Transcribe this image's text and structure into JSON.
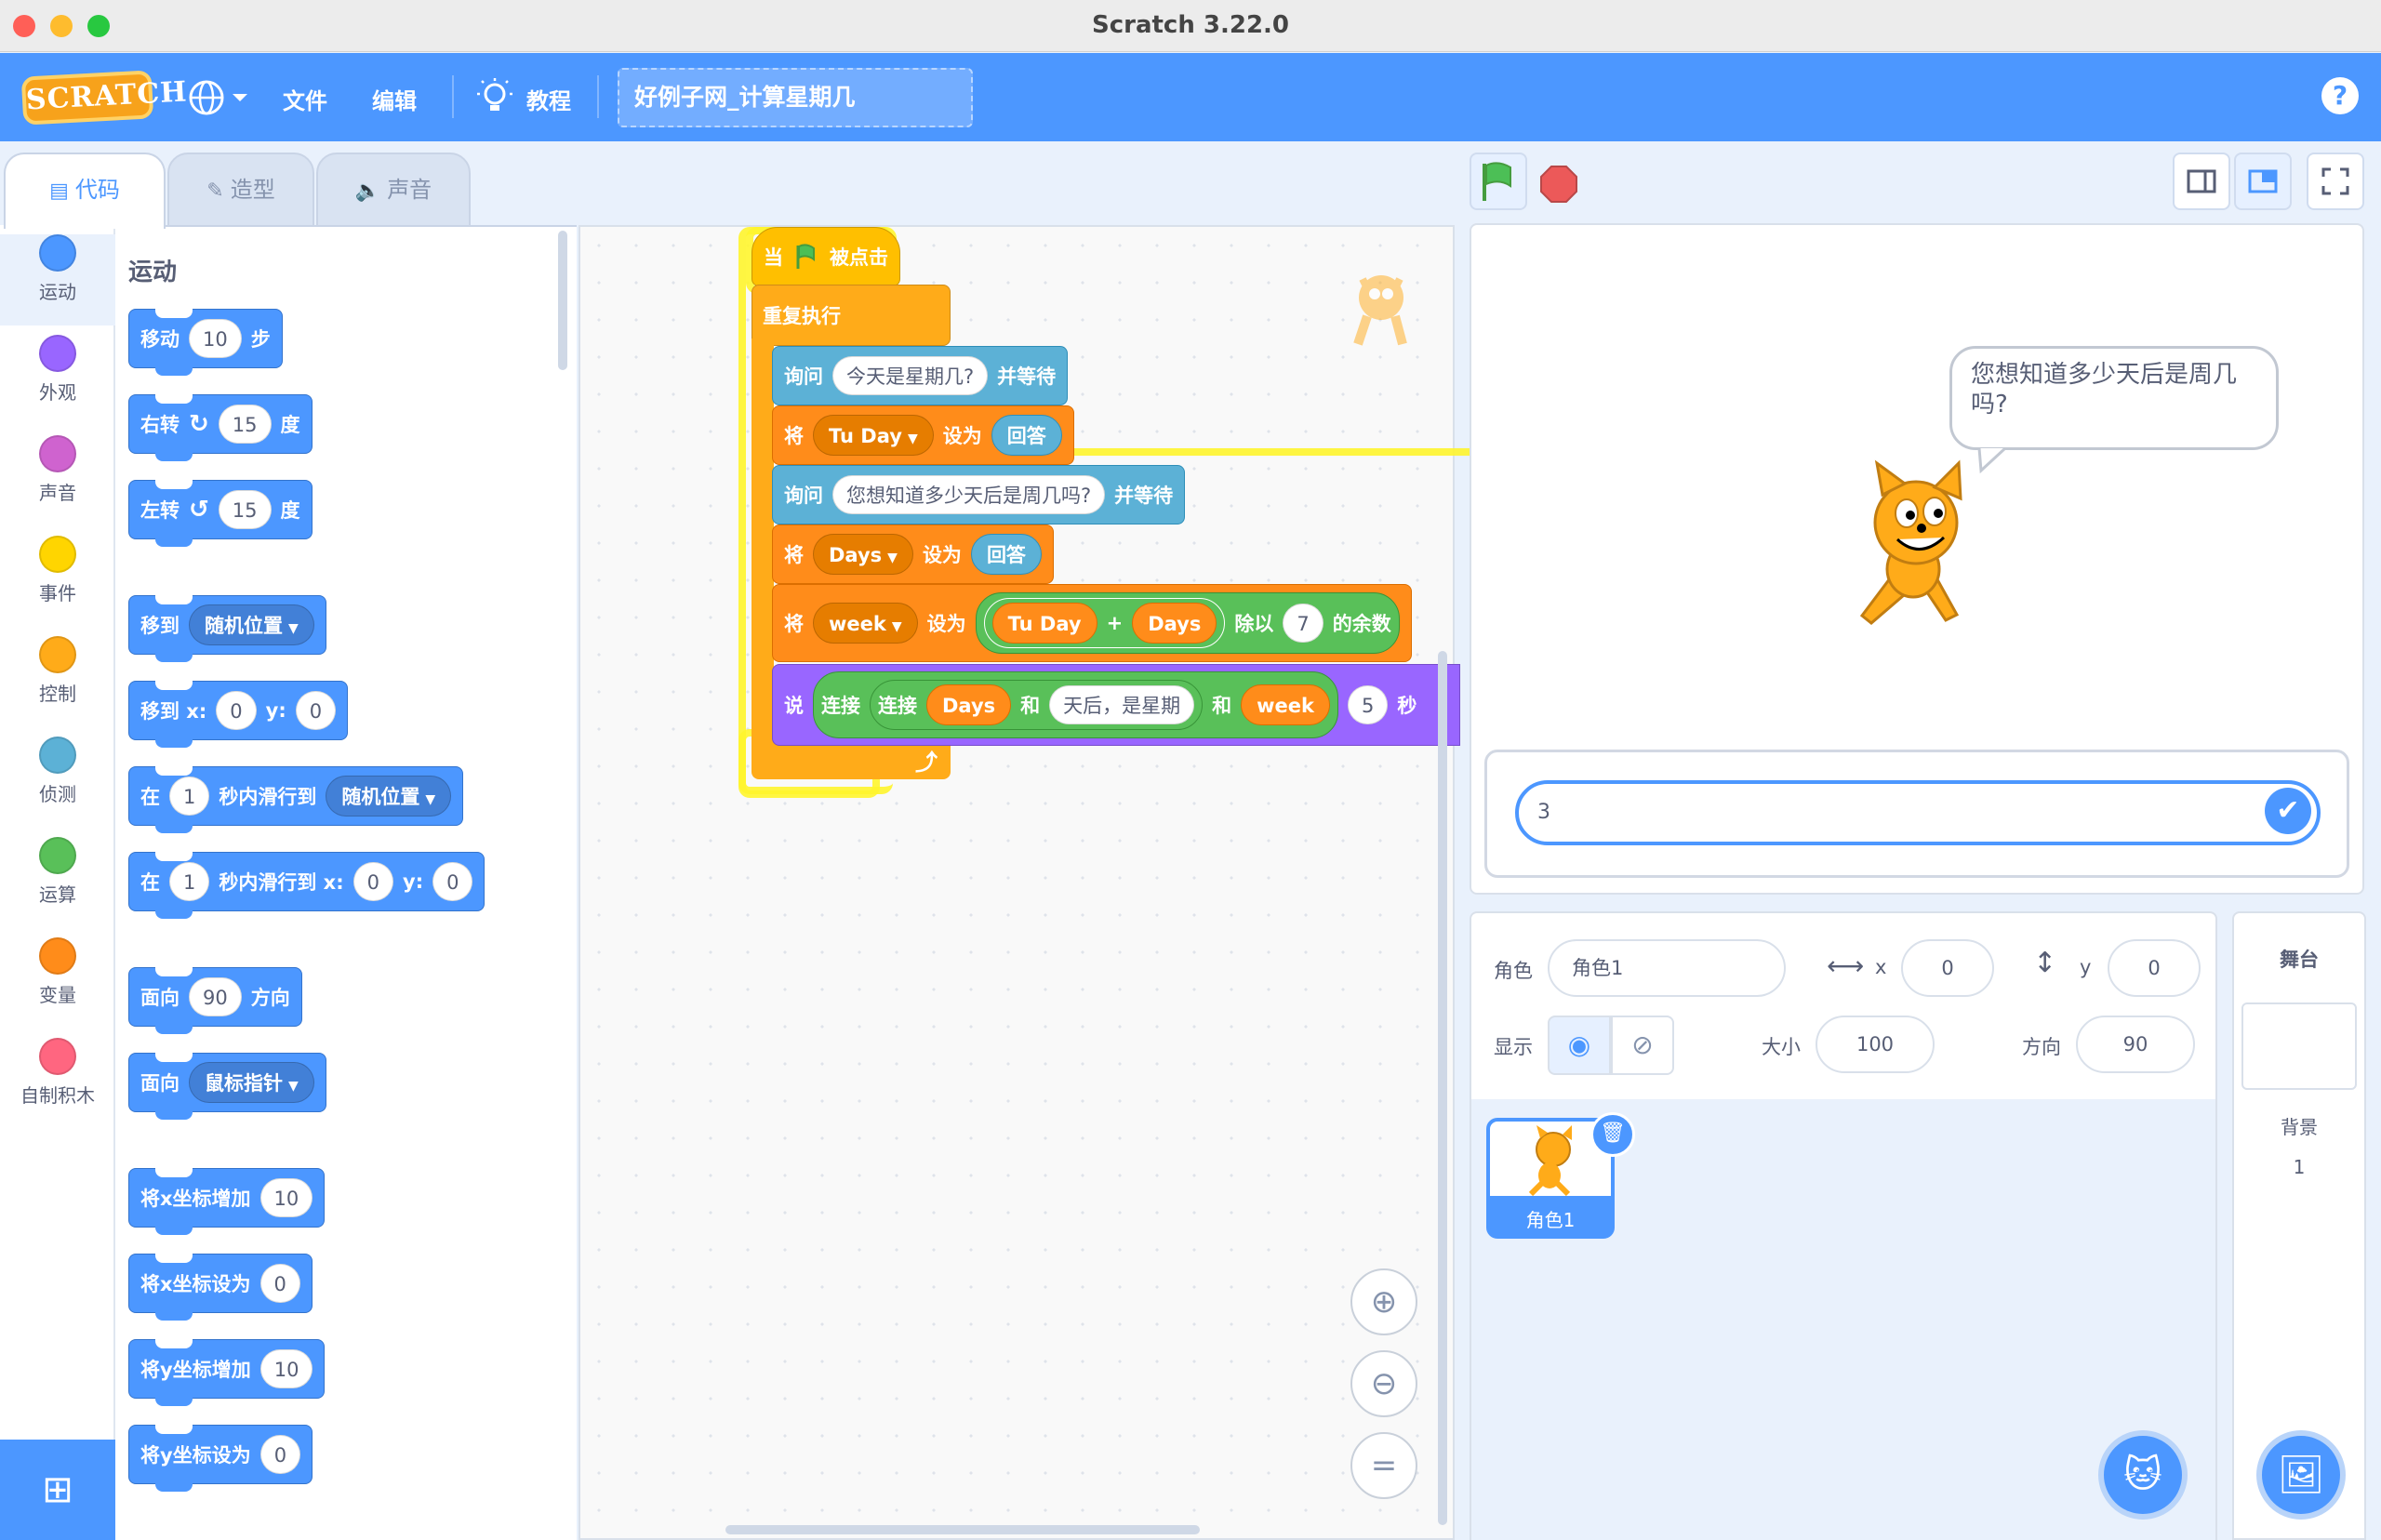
{
  "window": {
    "title": "Scratch 3.22.0"
  },
  "menubar": {
    "logo": "SCRATCH",
    "file": "文件",
    "edit": "编辑",
    "tutorials": "教程",
    "project_title": "好例子网_计算星期几",
    "help": "?"
  },
  "tabs": {
    "code": "代码",
    "costumes": "造型",
    "sounds": "声音"
  },
  "categories": [
    {
      "label": "运动",
      "color": "#4c97ff"
    },
    {
      "label": "外观",
      "color": "#9966ff"
    },
    {
      "label": "声音",
      "color": "#cf63cf"
    },
    {
      "label": "事件",
      "color": "#ffd500"
    },
    {
      "label": "控制",
      "color": "#ffab19"
    },
    {
      "label": "侦测",
      "color": "#5cb1d6"
    },
    {
      "label": "运算",
      "color": "#59c059"
    },
    {
      "label": "变量",
      "color": "#ff8c1a"
    },
    {
      "label": "自制积木",
      "color": "#ff6680"
    }
  ],
  "palette": {
    "title": "运动",
    "move": {
      "a": "移动",
      "n": "10",
      "b": "步"
    },
    "turn_right": {
      "a": "右转",
      "n": "15",
      "b": "度"
    },
    "turn_left": {
      "a": "左转",
      "n": "15",
      "b": "度"
    },
    "goto": {
      "a": "移到",
      "dd": "随机位置"
    },
    "goto_xy": {
      "a": "移到 x:",
      "x": "0",
      "yl": "y:",
      "y": "0"
    },
    "glide": {
      "a": "在",
      "n": "1",
      "b": "秒内滑行到",
      "dd": "随机位置"
    },
    "glide_xy": {
      "a": "在",
      "n": "1",
      "b": "秒内滑行到 x:",
      "x": "0",
      "yl": "y:",
      "y": "0"
    },
    "point_dir": {
      "a": "面向",
      "n": "90",
      "b": "方向"
    },
    "point_towards": {
      "a": "面向",
      "dd": "鼠标指针"
    },
    "change_x": {
      "a": "将x坐标增加",
      "n": "10"
    },
    "set_x": {
      "a": "将x坐标设为",
      "n": "0"
    },
    "change_y": {
      "a": "将y坐标增加",
      "n": "10"
    },
    "set_y": {
      "a": "将y坐标设为",
      "n": "0"
    }
  },
  "script": {
    "hat": {
      "a": "当",
      "b": "被点击"
    },
    "forever": "重复执行",
    "ask1": {
      "a": "询问",
      "q": "今天是星期几?",
      "b": "并等待"
    },
    "set1": {
      "a": "将",
      "var": "Tu Day",
      "b": "设为",
      "v": "回答"
    },
    "ask2": {
      "a": "询问",
      "q": "您想知道多少天后是周几吗?",
      "b": "并等待"
    },
    "set2": {
      "a": "将",
      "var": "Days",
      "b": "设为",
      "v": "回答"
    },
    "set3": {
      "a": "将",
      "var": "week",
      "b": "设为",
      "v1": "Tu Day",
      "plus": "+",
      "v2": "Days",
      "mod": "除以",
      "n": "7",
      "mod2": "的余数"
    },
    "say": {
      "a": "说",
      "j1": "连接",
      "j2": "连接",
      "v1": "Days",
      "and1": "和",
      "s": "天后，是星期",
      "and2": "和",
      "v2": "week",
      "n": "5",
      "b": "秒"
    }
  },
  "stage": {
    "bubble": "您想知道多少天后是周几吗?",
    "ask_value": "3"
  },
  "sprite": {
    "label": "角色",
    "name": "角色1",
    "x_label": "x",
    "x": "0",
    "y_label": "y",
    "y": "0",
    "show_label": "显示",
    "size_label": "大小",
    "size": "100",
    "dir_label": "方向",
    "dir": "90",
    "thumb_name": "角色1"
  },
  "stage_pane": {
    "title": "舞台",
    "bg_label": "背景",
    "bg_count": "1"
  }
}
